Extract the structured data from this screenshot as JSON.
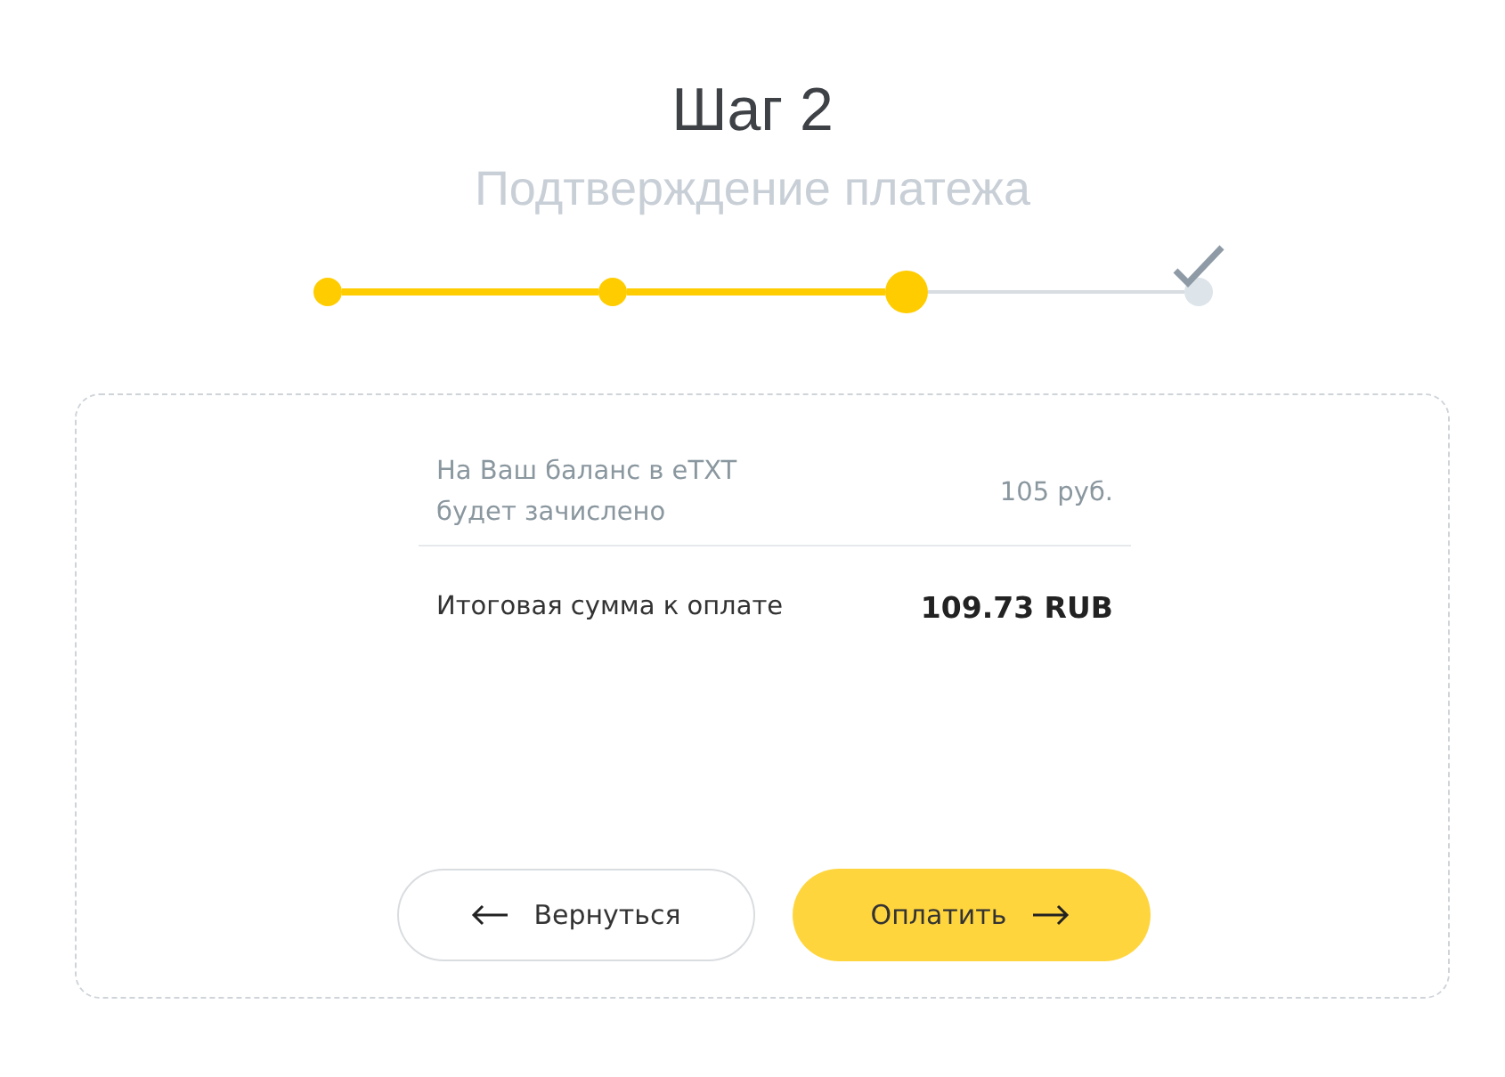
{
  "header": {
    "title": "Шаг 2",
    "subtitle": "Подтверждение платежа"
  },
  "steps": [
    {
      "kind": "done"
    },
    {
      "kind": "done"
    },
    {
      "kind": "current"
    },
    {
      "kind": "final"
    }
  ],
  "summary": [
    {
      "kind": "muted",
      "label": "На Ваш баланс в eTXT будет зачислено",
      "value": "105 руб."
    },
    {
      "kind": "total",
      "label": "Итоговая сумма к оплате",
      "value": "109.73 RUB"
    }
  ],
  "buttons": [
    {
      "kind": "back",
      "label": "Вернуться"
    },
    {
      "kind": "primary",
      "label": "Оплатить"
    }
  ]
}
